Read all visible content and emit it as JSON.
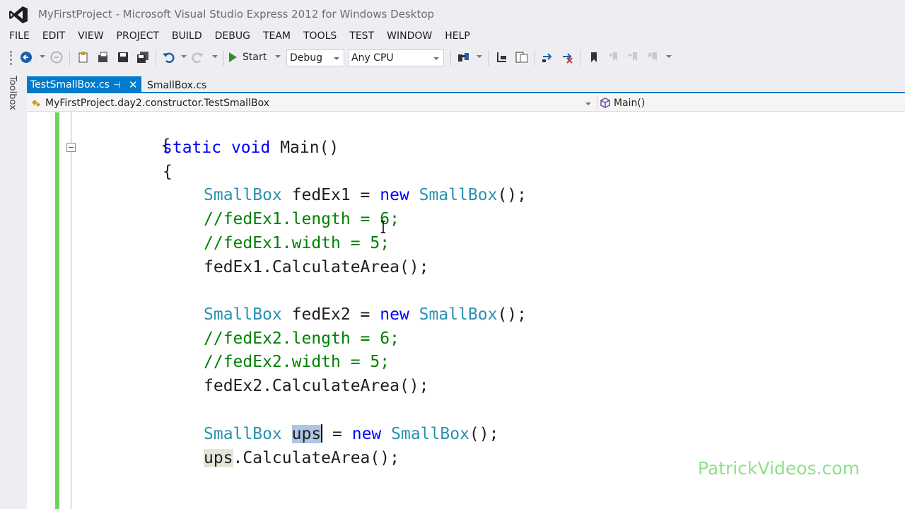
{
  "window": {
    "title": "MyFirstProject - Microsoft Visual Studio Express 2012 for Windows Desktop"
  },
  "menu": [
    "FILE",
    "EDIT",
    "VIEW",
    "PROJECT",
    "BUILD",
    "DEBUG",
    "TEAM",
    "TOOLS",
    "TEST",
    "WINDOW",
    "HELP"
  ],
  "toolbar": {
    "start_label": "Start",
    "configuration": "Debug",
    "platform": "Any CPU"
  },
  "toolbox": {
    "label": "Toolbox"
  },
  "tabs": [
    {
      "label": "TestSmallBox.cs",
      "active": true
    },
    {
      "label": "SmallBox.cs",
      "active": false
    }
  ],
  "navbar": {
    "class_path": "MyFirstProject.day2.constructor.TestSmallBox",
    "member": "Main()"
  },
  "code": {
    "brace_outer": "{",
    "main_sig": {
      "kw1": "static",
      "kw2": "void",
      "name": " Main()"
    },
    "brace_inner": "{",
    "l1": {
      "type": "SmallBox",
      "mid": " fedEx1 = ",
      "kw": "new",
      "type2": "SmallBox",
      "end": "();"
    },
    "l2": "//fedEx1.length = 6;",
    "l3": "//fedEx1.width = 5;",
    "l4": "fedEx1.CalculateArea();",
    "l5": {
      "type": "SmallBox",
      "mid": " fedEx2 = ",
      "kw": "new",
      "type2": "SmallBox",
      "end": "();"
    },
    "l6": "//fedEx2.length = 6;",
    "l7": "//fedEx2.width = 5;",
    "l8": "fedEx2.CalculateArea();",
    "l9": {
      "type": "SmallBox",
      "sel": "ups",
      "mid": " = ",
      "kw": "new",
      "type2": "SmallBox",
      "end": "();"
    },
    "l10": {
      "ref": "ups",
      "rest": ".CalculateArea();"
    }
  },
  "watermark": "PatrickVideos.com",
  "colors": {
    "accent": "#007acc",
    "keyword": "#0000ff",
    "type": "#2b91af",
    "comment": "#008000",
    "change_bar": "#6cd35b"
  }
}
